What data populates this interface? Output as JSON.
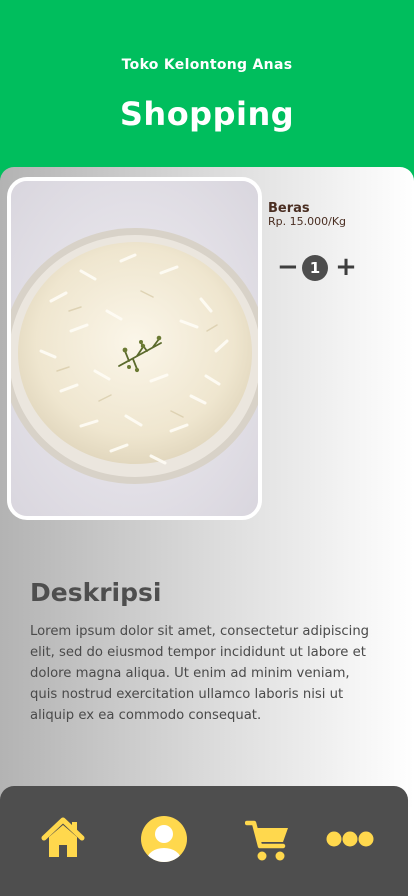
{
  "header": {
    "store_name": "Toko Kelontong Anas",
    "title": "Shopping"
  },
  "product": {
    "name": "Beras",
    "price": "Rp. 15.000/Kg",
    "image_icon": "rice-bowl-photo",
    "quantity": "1",
    "decrement_symbol": "−",
    "increment_symbol": "+"
  },
  "description": {
    "heading": "Deskripsi",
    "body": "Lorem ipsum dolor sit amet, consectetur adipiscing elit, sed do eiusmod tempor incididunt ut labore et dolore magna aliqua. Ut enim ad minim veniam, quis nostrud exercitation ullamco laboris nisi ut aliquip ex ea commodo consequat."
  },
  "bottom_nav": {
    "items": [
      {
        "icon": "home-icon"
      },
      {
        "icon": "user-icon"
      },
      {
        "icon": "cart-icon"
      },
      {
        "icon": "more-icon"
      }
    ]
  },
  "colors": {
    "header_green": "#00be5d",
    "nav_background": "#4e4e4e",
    "nav_icon_yellow": "#ffd84d",
    "text_brown": "#4a2e22"
  }
}
